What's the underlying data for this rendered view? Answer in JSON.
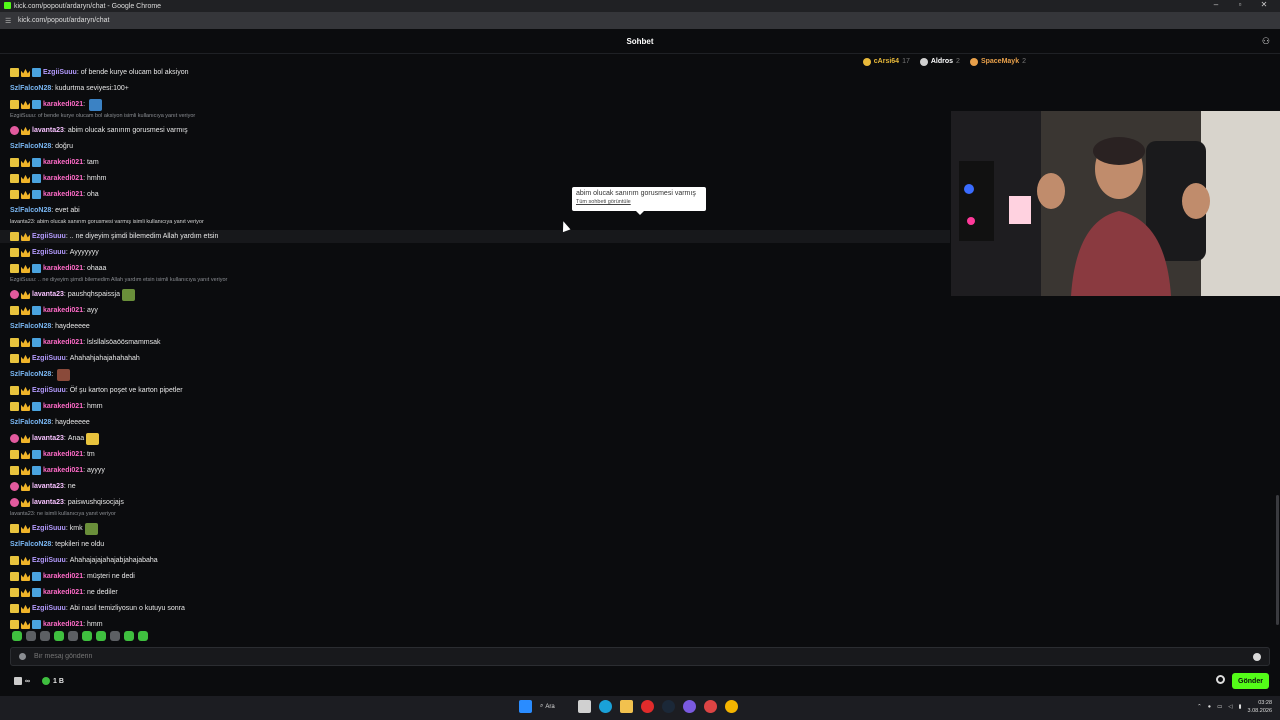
{
  "window": {
    "title": "kick.com/popout/ardaryn/chat - Google Chrome",
    "url": "kick.com/popout/ardaryn/chat"
  },
  "header": {
    "title": "Sohbet"
  },
  "top_gifters": [
    {
      "name": "cArsi64",
      "count": "17",
      "color": "#e8b93a"
    },
    {
      "name": "Aldros",
      "count": "2",
      "color": "#d0d0d0"
    },
    {
      "name": "SpaceMayk",
      "count": "2",
      "color": "#e8a04a"
    }
  ],
  "tooltip": {
    "text": "abim olucak sanırım gorusmesi varmış",
    "link": "Tüm sohbeti görüntüle"
  },
  "messages": [
    {
      "type": "msg",
      "user": "EzgiiSuuu",
      "color": "#b39afd",
      "badges": [
        "sub",
        "crown",
        "blue"
      ],
      "text": "of bende kurye olucam bol aksiyon"
    },
    {
      "type": "msg",
      "user": "SzlFalcoN28",
      "color": "#7ab8f5",
      "badges": [],
      "text": "kudurtma seviyesi:100+"
    },
    {
      "type": "msg",
      "user": "karakedi021",
      "color": "#ff6bc8",
      "badges": [
        "sub",
        "crown",
        "blue"
      ],
      "text": "",
      "emote": "#3b82c4"
    },
    {
      "type": "reply",
      "text": "EzgiiSuuu: of bende kurye olucam bol aksiyon isimli kullanıcıya yanıt veriyor"
    },
    {
      "type": "msg",
      "user": "lavanta23",
      "color": "#f7c1ff",
      "badges": [
        "pink",
        "crown"
      ],
      "text": "abim olucak sanırım gorusmesi varmış"
    },
    {
      "type": "msg",
      "user": "SzlFalcoN28",
      "color": "#7ab8f5",
      "badges": [],
      "text": "doğru"
    },
    {
      "type": "msg",
      "user": "karakedi021",
      "color": "#ff6bc8",
      "badges": [
        "sub",
        "crown",
        "blue"
      ],
      "text": "tam"
    },
    {
      "type": "msg",
      "user": "karakedi021",
      "color": "#ff6bc8",
      "badges": [
        "sub",
        "crown",
        "blue"
      ],
      "text": "hmhm"
    },
    {
      "type": "msg",
      "user": "karakedi021",
      "color": "#ff6bc8",
      "badges": [
        "sub",
        "crown",
        "blue"
      ],
      "text": "oha"
    },
    {
      "type": "msg",
      "user": "SzlFalcoN28",
      "color": "#7ab8f5",
      "badges": [],
      "text": "evet abi"
    },
    {
      "type": "reply",
      "text": "lavanta23: abim olucak sanırım gorusmesi varmış isimli kullanıcıya yanıt veriyor",
      "highlight": true
    },
    {
      "type": "msg",
      "user": "EzgiiSuuu",
      "color": "#b39afd",
      "badges": [
        "sub",
        "crown"
      ],
      "text": ".. ne diyeyim şimdi bilemedim Allah yardım etsin",
      "highlight": true
    },
    {
      "type": "msg",
      "user": "EzgiiSuuu",
      "color": "#b39afd",
      "badges": [
        "sub",
        "crown"
      ],
      "text": "Ayyyyyyy"
    },
    {
      "type": "msg",
      "user": "karakedi021",
      "color": "#ff6bc8",
      "badges": [
        "sub",
        "crown",
        "blue"
      ],
      "text": "ohaaa"
    },
    {
      "type": "reply",
      "text": "EzgiiSuuu: .. ne diyeyim şimdi bilemedim Allah yardım etsin isimli kullanıcıya yanıt veriyor"
    },
    {
      "type": "msg",
      "user": "lavanta23",
      "color": "#f7c1ff",
      "badges": [
        "pink",
        "crown"
      ],
      "text": "paushqhspaissja",
      "emote": "#6a8f3a"
    },
    {
      "type": "msg",
      "user": "karakedi021",
      "color": "#ff6bc8",
      "badges": [
        "sub",
        "crown",
        "blue"
      ],
      "text": "ayy"
    },
    {
      "type": "msg",
      "user": "SzlFalcoN28",
      "color": "#7ab8f5",
      "badges": [],
      "text": "haydeeeee"
    },
    {
      "type": "msg",
      "user": "karakedi021",
      "color": "#ff6bc8",
      "badges": [
        "sub",
        "crown",
        "blue"
      ],
      "text": "lslsllalsöaöösmammsak"
    },
    {
      "type": "msg",
      "user": "EzgiiSuuu",
      "color": "#b39afd",
      "badges": [
        "sub",
        "crown"
      ],
      "text": "Ahahahjahajahahahah"
    },
    {
      "type": "msg",
      "user": "SzlFalcoN28",
      "color": "#7ab8f5",
      "badges": [],
      "text": "",
      "emote": "#8a4a3a"
    },
    {
      "type": "msg",
      "user": "EzgiiSuuu",
      "color": "#b39afd",
      "badges": [
        "sub",
        "crown"
      ],
      "text": "Öf şu karton poşet ve karton pipetler"
    },
    {
      "type": "msg",
      "user": "karakedi021",
      "color": "#ff6bc8",
      "badges": [
        "sub",
        "crown",
        "blue"
      ],
      "text": "hmm"
    },
    {
      "type": "msg",
      "user": "SzlFalcoN28",
      "color": "#7ab8f5",
      "badges": [],
      "text": "haydeeeee"
    },
    {
      "type": "msg",
      "user": "lavanta23",
      "color": "#f7c1ff",
      "badges": [
        "pink",
        "crown"
      ],
      "text": "Anaa",
      "emote": "#e8c33d"
    },
    {
      "type": "msg",
      "user": "karakedi021",
      "color": "#ff6bc8",
      "badges": [
        "sub",
        "crown",
        "blue"
      ],
      "text": "tm"
    },
    {
      "type": "msg",
      "user": "karakedi021",
      "color": "#ff6bc8",
      "badges": [
        "sub",
        "crown",
        "blue"
      ],
      "text": "ayyyy"
    },
    {
      "type": "msg",
      "user": "lavanta23",
      "color": "#f7c1ff",
      "badges": [
        "pink",
        "crown"
      ],
      "text": "ne"
    },
    {
      "type": "msg",
      "user": "lavanta23",
      "color": "#f7c1ff",
      "badges": [
        "pink",
        "crown"
      ],
      "text": "paiswushqisocjajs"
    },
    {
      "type": "reply",
      "text": "lavanta23: ne isimli kullanıcıya yanıt veriyor"
    },
    {
      "type": "msg",
      "user": "EzgiiSuuu",
      "color": "#b39afd",
      "badges": [
        "sub",
        "crown"
      ],
      "text": "kmk",
      "emote": "#6a8f3a"
    },
    {
      "type": "msg",
      "user": "SzlFalcoN28",
      "color": "#7ab8f5",
      "badges": [],
      "text": "tepkileri ne oldu"
    },
    {
      "type": "msg",
      "user": "EzgiiSuuu",
      "color": "#b39afd",
      "badges": [
        "sub",
        "crown"
      ],
      "text": "Ahahajajajahajabjahajabaha"
    },
    {
      "type": "msg",
      "user": "karakedi021",
      "color": "#ff6bc8",
      "badges": [
        "sub",
        "crown",
        "blue"
      ],
      "text": "müşteri ne dedi"
    },
    {
      "type": "msg",
      "user": "karakedi021",
      "color": "#ff6bc8",
      "badges": [
        "sub",
        "crown",
        "blue"
      ],
      "text": "ne dediler"
    },
    {
      "type": "msg",
      "user": "EzgiiSuuu",
      "color": "#b39afd",
      "badges": [
        "sub",
        "crown"
      ],
      "text": "Abi nasıl temizliyosun o kutuyu sonra"
    },
    {
      "type": "msg",
      "user": "karakedi021",
      "color": "#ff6bc8",
      "badges": [
        "sub",
        "crown",
        "blue"
      ],
      "text": "hmm"
    }
  ],
  "input": {
    "placeholder": "Bir mesaj gönderin"
  },
  "bottom": {
    "viewers_label": "∞",
    "points_label": "1 B",
    "send_label": "Gönder"
  },
  "taskbar": {
    "search_label": "Ara",
    "time": "03:28",
    "date": "3.08.2026"
  }
}
